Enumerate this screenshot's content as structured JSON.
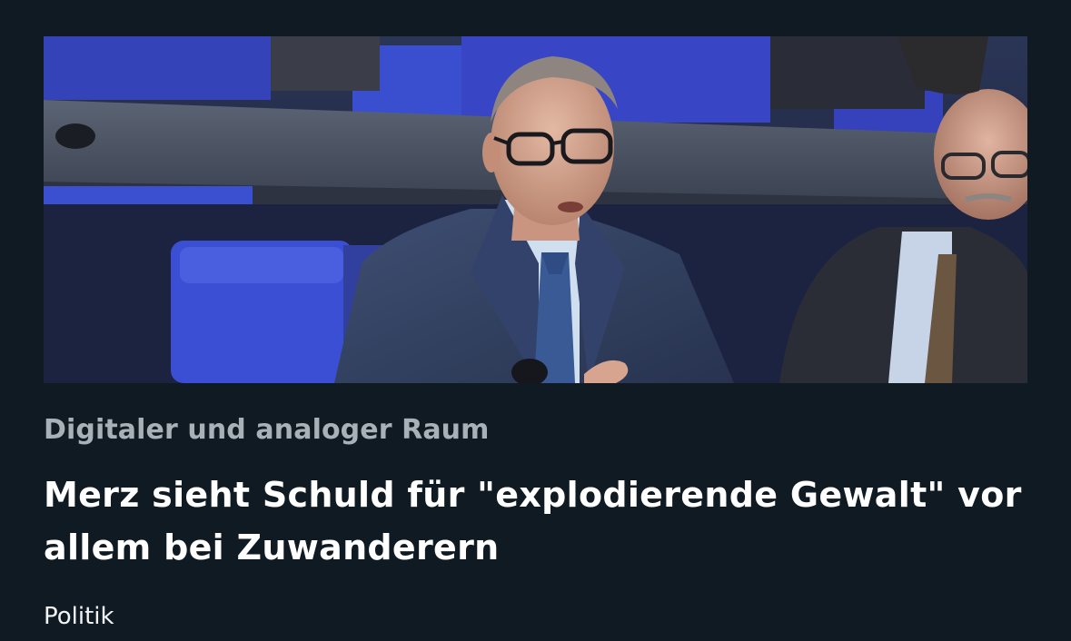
{
  "article": {
    "image_alt": "Merz spricht im Bundestag am Rednerpult",
    "kicker": "Digitaler und analoger Raum",
    "headline": "Merz sieht Schuld für \"explodierende Gewalt\" vor allem bei Zuwanderern",
    "category": "Politik"
  },
  "colors": {
    "background": "#101a22",
    "kicker": "#a8b0b8",
    "headline": "#ffffff",
    "seat_blue": "#3a4fcf"
  }
}
